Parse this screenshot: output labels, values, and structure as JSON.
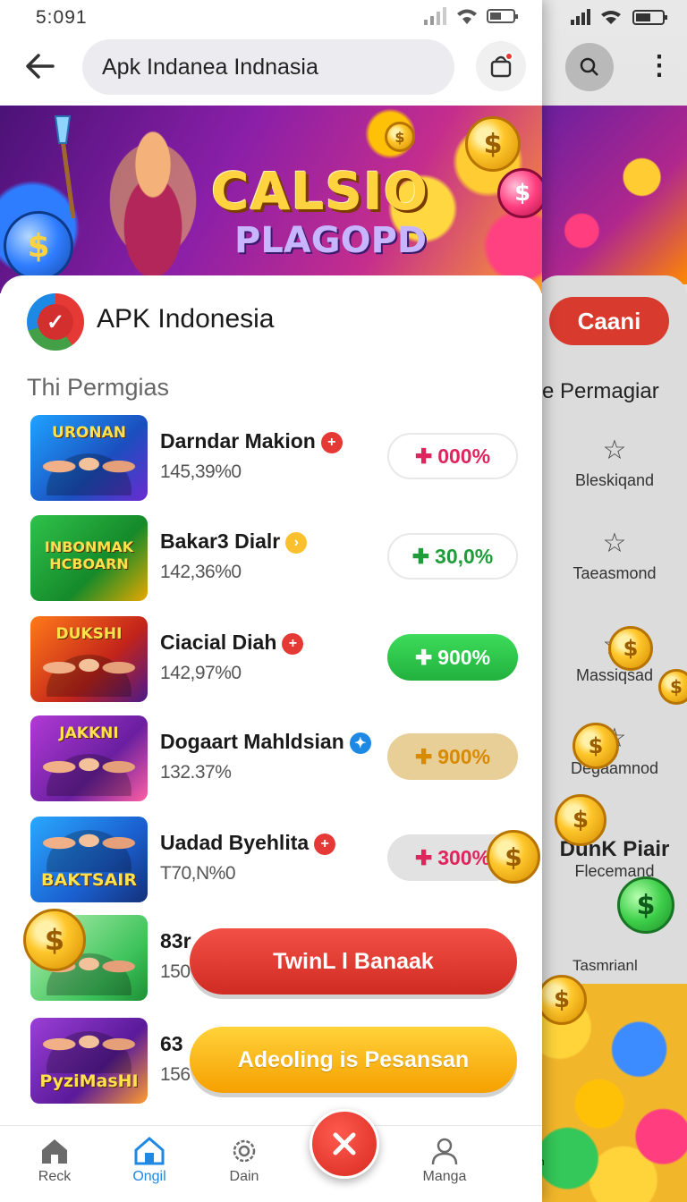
{
  "status": {
    "time": "5:091"
  },
  "header": {
    "search_text": "Apk Indanea Indnasia"
  },
  "banner": {
    "title": "CALSIO",
    "subtitle": "PLAGOPD"
  },
  "brand": {
    "name": "APK Indonesia"
  },
  "section_title": "Thi Permgias",
  "apps": [
    {
      "thumb": "URONAN",
      "title": "Darndar Makion",
      "sub": "145,39%0",
      "pct": "000%",
      "badge_color": "#e53935",
      "pct_style": "outline-pink"
    },
    {
      "thumb": "INBONMAK HCBOARN",
      "title": "Bakar3 Dialr",
      "sub": "142,36%0",
      "pct": "30,0%",
      "badge_color": "#fbc02d",
      "pct_style": "outline-green"
    },
    {
      "thumb": "DUKSHI",
      "title": "Ciacial Diah",
      "sub": "142,97%0",
      "pct": "900%",
      "badge_color": "#e53935",
      "pct_style": "solid-green"
    },
    {
      "thumb": "JAKKNI",
      "title": "Dogaart Mahldsian",
      "sub": "132.37%",
      "pct": "900%",
      "badge_color": "#1e88e5",
      "pct_style": "solid-tan"
    },
    {
      "thumb": "BAKTSAIR",
      "title": "Uadad Byehlita",
      "sub": "T70,N%0",
      "pct": "300%",
      "badge_color": "#e53935",
      "pct_style": "solid-grey"
    },
    {
      "thumb": "",
      "title": "83r",
      "sub": "150",
      "pct": "",
      "badge_color": "",
      "pct_style": "none"
    },
    {
      "thumb": "PyziMasHI",
      "title": "63",
      "sub": "156",
      "pct": "",
      "badge_color": "",
      "pct_style": "none"
    }
  ],
  "buttons": {
    "primary": "TwinL l Banaak",
    "secondary": "Adeoling is Pesansan"
  },
  "nav": [
    {
      "label": "Reck",
      "icon": "home-icon"
    },
    {
      "label": "Ongil",
      "icon": "home-active-icon"
    },
    {
      "label": "Dain",
      "icon": "settings-icon"
    },
    {
      "label": "Manga",
      "icon": "user-icon"
    }
  ],
  "background_screen": {
    "pill": "Caani",
    "section": "e Permagiar",
    "items": [
      "Bleskiqand",
      "Taeasmond",
      "Massiqsad",
      "Degaamnod"
    ],
    "dunk": "DunK Piair",
    "dunk_sub": "Flecemand",
    "tail": "Tasmrianl",
    "nav_partial": "Pn"
  },
  "colors": {
    "accent_red": "#e53935",
    "accent_green": "#2ecc40",
    "accent_yellow": "#f6a000",
    "active_blue": "#1e88e5"
  }
}
